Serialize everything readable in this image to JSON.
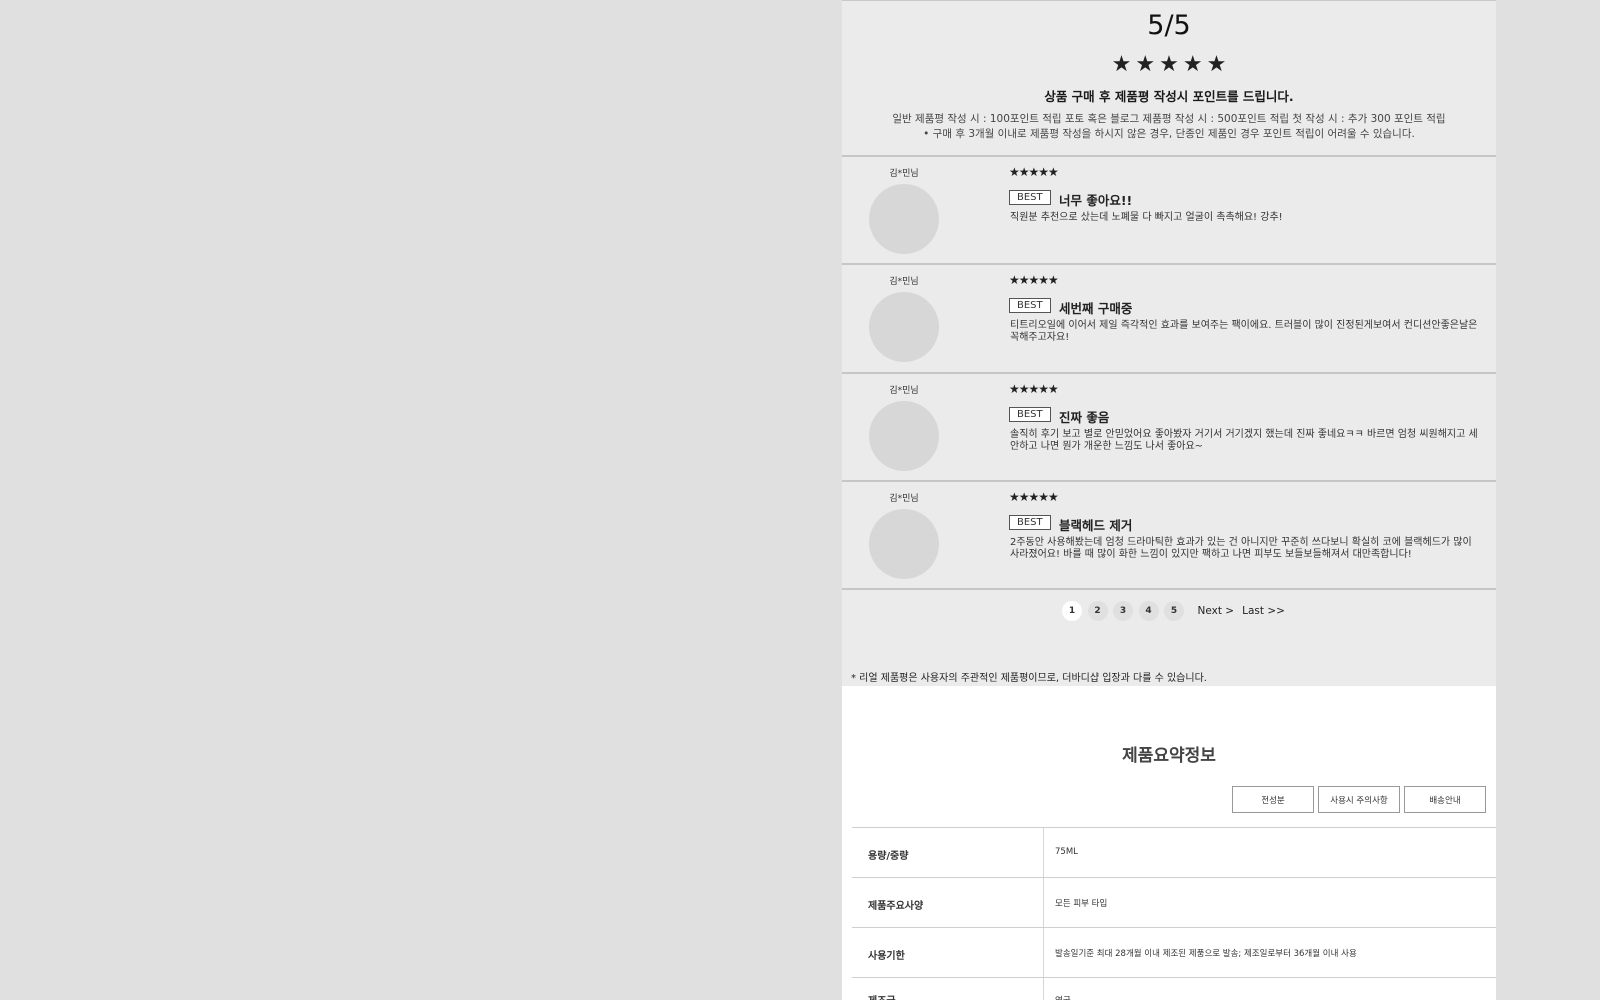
{
  "rating": {
    "score": "5/5",
    "stars": "★★★★★",
    "promo_title": "상품 구매 후 제품평 작성시 포인트를 드립니다.",
    "promo_line1": "일반 제품평 작성 시 : 100포인트 적립 포토 혹은 블로그 제품평 작성 시 : 500포인트 적립 첫 작성 시 : 추가 300 포인트 적립",
    "promo_line2": "•  구매 후 3개월 이내로 제품평 작성을 하시지 않은 경우, 단종인 제품인 경우 포인트 적립이 어려울 수 있습니다."
  },
  "reviews": [
    {
      "reviewer": "김*민님",
      "stars": "★★★★★",
      "badge": "BEST",
      "title": "너무 좋아요!!",
      "body": "직원분 추천으로 샀는데 노폐물 다 빠지고 얼굴이 촉촉해요! 강추!"
    },
    {
      "reviewer": "김*민님",
      "stars": "★★★★★",
      "badge": "BEST",
      "title": "세번째 구매중",
      "body": "티트리오일에 이어서 제일 즉각적인 효과를 보여주는 팩이에요. 트러블이 많이 진정된게보여서 컨디션안좋은날은 꼭해주고자요!"
    },
    {
      "reviewer": "김*민님",
      "stars": "★★★★★",
      "badge": "BEST",
      "title": "진짜 좋음",
      "body": "솔직히 후기 보고 별로 안믿었어요 좋아봤자 거기서 거기겠지 했는데 진짜 좋네요ㅋㅋ 바르면 엄청 씨원해지고 세안하고 나면 뭔가 개운한 느낌도 나서 좋아요~"
    },
    {
      "reviewer": "김*민님",
      "stars": "★★★★★",
      "badge": "BEST",
      "title": "블랙헤드 제거",
      "body": "2주동안 사용해봤는데 엄청 드라마틱한 효과가 있는 건 아니지만 꾸준히 쓰다보니 확실히 코에 블랙헤드가 많이 사라졌어요! 바를 때 많이 화한 느낌이 있지만 팩하고 나면 피부도 보들보들해져서 대만족합니다!"
    }
  ],
  "pagination": {
    "pages": [
      "1",
      "2",
      "3",
      "4",
      "5"
    ],
    "current": "1",
    "next": "Next >",
    "last": "Last >>"
  },
  "notice": "* 리얼 제품평은 사용자의 주관적인 제품평이므로, 더바디샵 입장과 다를 수 있습니다.",
  "product_info": {
    "title": "제품요약정보",
    "buttons": [
      "전성분",
      "사용시 주의사항",
      "배송안내"
    ],
    "rows": [
      {
        "label": "용량/중량",
        "value": "75ML"
      },
      {
        "label": "제품주요사양",
        "value": "모든 피부 타입"
      },
      {
        "label": "사용기한",
        "value": "발송일기준 최대 28개월 이내 제조된 제품으로 발송; 제조일로부터 36개월 이내 사용"
      },
      {
        "label": "제조국",
        "value": "영국"
      }
    ]
  }
}
